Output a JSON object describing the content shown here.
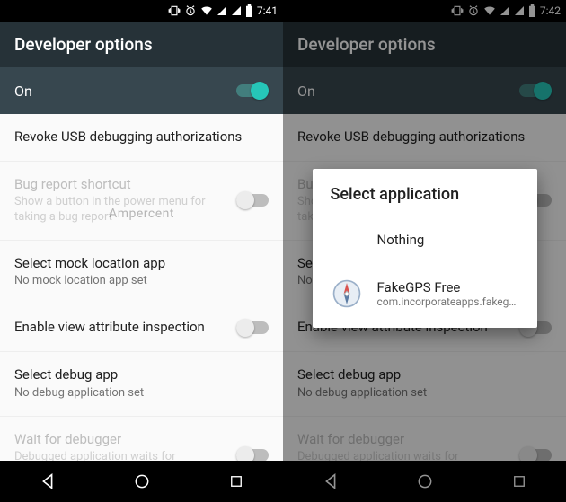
{
  "left": {
    "status": {
      "time": "7:41"
    },
    "title": "Developer options",
    "onbar": {
      "label": "On",
      "enabled": true
    },
    "rows": {
      "revoke": {
        "title": "Revoke USB debugging authorizations"
      },
      "bugreport": {
        "title": "Bug report shortcut",
        "sub": "Show a button in the power menu for taking a bug report"
      },
      "mock": {
        "title": "Select mock location app",
        "sub": "No mock location app set"
      },
      "viewattr": {
        "title": "Enable view attribute inspection"
      },
      "debugapp": {
        "title": "Select debug app",
        "sub": "No debug application set"
      },
      "waitdbg": {
        "title": "Wait for debugger",
        "sub": "Debugged application waits for debugger to attach before executing"
      }
    },
    "watermark": "Ampercent"
  },
  "right": {
    "status": {
      "time": "7:42"
    },
    "title": "Developer options",
    "onbar": {
      "label": "On",
      "enabled": true
    },
    "rows": {
      "revoke": {
        "title": "Revoke USB debugging authorizations"
      },
      "bugreport": {
        "title": "Bug report shortcut",
        "sub": "Show a button in the power menu for taking a bug report"
      },
      "mock": {
        "title": "Select mock location app",
        "sub": "No mock location app set"
      },
      "viewattr": {
        "title": "Enable view attribute inspection"
      },
      "debugapp": {
        "title": "Select debug app",
        "sub": "No debug application set"
      },
      "waitdbg": {
        "title": "Wait for debugger",
        "sub": "Debugged application waits for debugger to attach before executing"
      }
    },
    "dialog": {
      "title": "Select application",
      "items": [
        {
          "title": "Nothing",
          "sub": ""
        },
        {
          "title": "FakeGPS Free",
          "sub": "com.incorporateapps.fakeg…"
        }
      ]
    }
  }
}
